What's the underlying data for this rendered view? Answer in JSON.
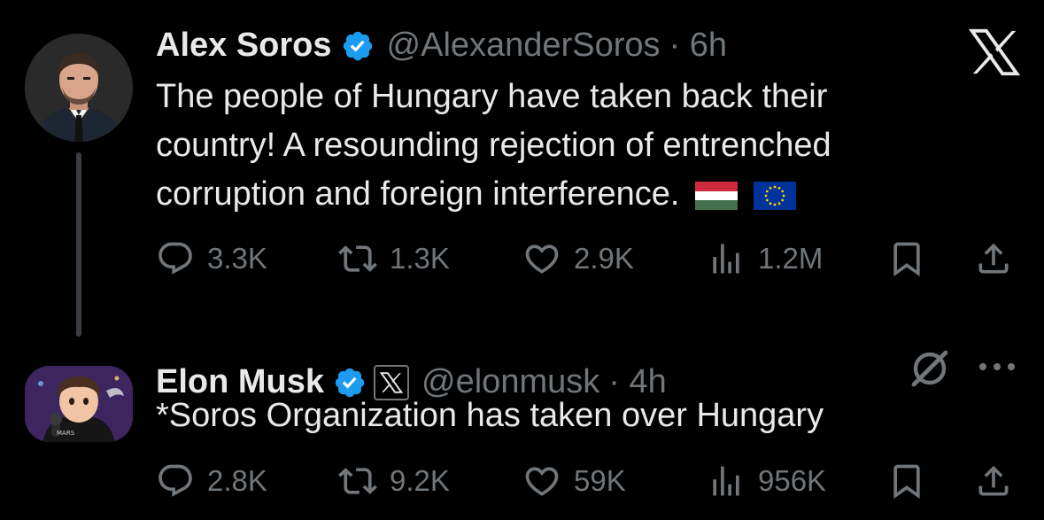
{
  "tweets": [
    {
      "name": "Alex Soros",
      "handle": "@AlexanderSoros",
      "time": "· 6h",
      "text": "The people of Hungary have taken back their\ncountry! A resounding rejection of entrenched\ncorruption and foreign interference.",
      "flags": [
        "hungary-flag-icon",
        "eu-flag-icon"
      ],
      "stats": {
        "replies": "3.3K",
        "reposts": "1.3K",
        "likes": "2.9K",
        "views": "1.2M"
      }
    },
    {
      "name": "Elon Musk",
      "handle": "@elonmusk",
      "time": "· 4h",
      "text": "*Soros Organization has taken over Hungary",
      "stats": {
        "replies": "2.8K",
        "reposts": "9.2K",
        "likes": "59K",
        "views": "956K"
      }
    }
  ],
  "icons": {
    "verified": "verified-badge-icon",
    "reply": "reply-icon",
    "repost": "repost-icon",
    "like": "like-icon",
    "views": "views-icon",
    "bookmark": "bookmark-icon",
    "share": "share-icon",
    "brand": "x-logo-icon",
    "grok": "grok-icon",
    "more": "more-icon"
  },
  "colors": {
    "background": "#000000",
    "text": "#e7e9ea",
    "secondary": "#71767b",
    "verified": "#1d9bf0",
    "thread_line": "#3a3d42"
  }
}
